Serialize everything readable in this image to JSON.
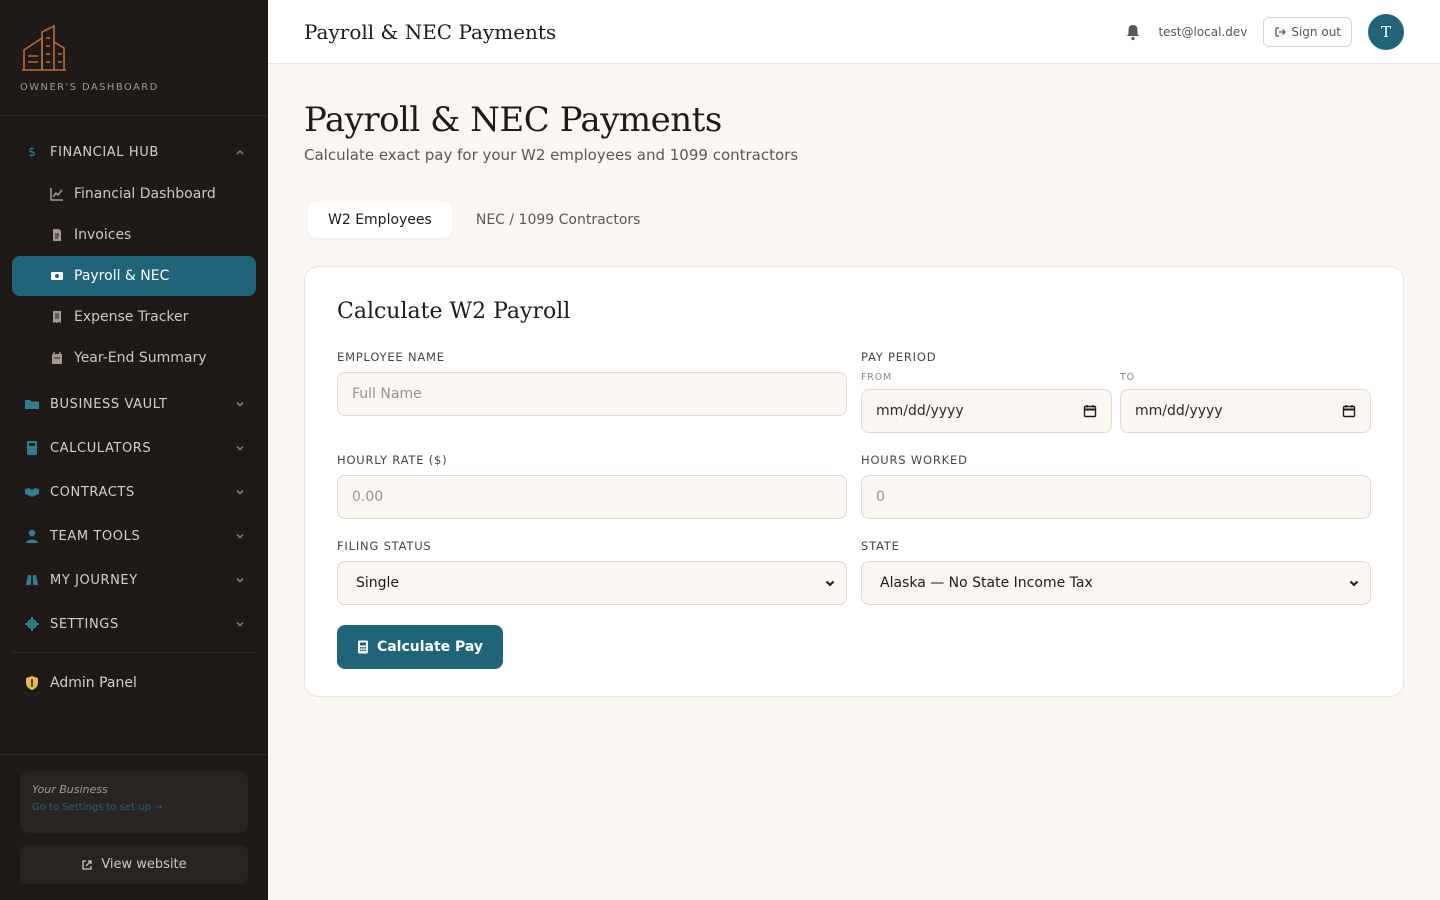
{
  "sidebar": {
    "brand_text": "OWNER'S DASHBOARD",
    "sections": [
      {
        "label": "FINANCIAL HUB",
        "icon": "dollar-icon",
        "expanded": true
      },
      {
        "label": "BUSINESS VAULT",
        "icon": "folder-icon",
        "expanded": false
      },
      {
        "label": "CALCULATORS",
        "icon": "calculator-icon",
        "expanded": false
      },
      {
        "label": "CONTRACTS",
        "icon": "handshake-icon",
        "expanded": false
      },
      {
        "label": "TEAM TOOLS",
        "icon": "user-icon",
        "expanded": false
      },
      {
        "label": "MY JOURNEY",
        "icon": "binoculars-icon",
        "expanded": false
      },
      {
        "label": "SETTINGS",
        "icon": "gear-icon",
        "expanded": false
      }
    ],
    "financial_items": [
      {
        "label": "Financial Dashboard",
        "icon": "chart-line-icon"
      },
      {
        "label": "Invoices",
        "icon": "file-invoice-icon"
      },
      {
        "label": "Payroll & NEC",
        "icon": "money-bill-icon",
        "active": true
      },
      {
        "label": "Expense Tracker",
        "icon": "receipt-icon"
      },
      {
        "label": "Year-End Summary",
        "icon": "calendar-icon"
      }
    ],
    "admin_label": "Admin Panel",
    "business_name": "Your Business",
    "business_link": "Go to Settings to set up →",
    "view_website": "View website"
  },
  "topbar": {
    "title": "Payroll & NEC Payments",
    "email": "test@local.dev",
    "signout": "Sign out",
    "avatar_initial": "T"
  },
  "main": {
    "title": "Payroll & NEC Payments",
    "subtitle": "Calculate exact pay for your W2 employees and 1099 contractors",
    "tabs": [
      {
        "label": "W2 Employees",
        "active": true
      },
      {
        "label": "NEC / 1099 Contractors",
        "active": false
      }
    ],
    "card": {
      "title": "Calculate W2 Payroll",
      "employee_name_label": "EMPLOYEE NAME",
      "employee_name_placeholder": "Full Name",
      "pay_period_label": "PAY PERIOD",
      "from_label": "FROM",
      "to_label": "TO",
      "from_value": "mm/dd/yyyy",
      "to_value": "mm/dd/yyyy",
      "hourly_rate_label": "HOURLY RATE ($)",
      "hourly_rate_placeholder": "0.00",
      "hours_worked_label": "HOURS WORKED",
      "hours_worked_placeholder": "0",
      "filing_status_label": "FILING STATUS",
      "filing_status_value": "Single",
      "state_label": "STATE",
      "state_value": "Alaska — No State Income Tax",
      "calculate_label": "Calculate Pay"
    }
  },
  "colors": {
    "sidebar_bg": "#1f1a17",
    "accent": "#1f6478",
    "page_bg": "#faf7f3",
    "admin_icon": "#e6b84a"
  }
}
